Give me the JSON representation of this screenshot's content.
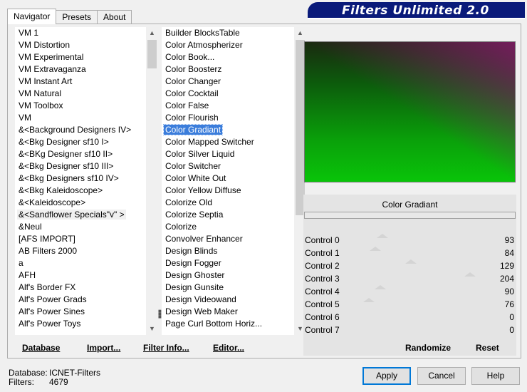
{
  "tabs": [
    "Navigator",
    "Presets",
    "About"
  ],
  "title": "Filters Unlimited 2.0",
  "categories": [
    "VM 1",
    "VM Distortion",
    "VM Experimental",
    "VM Extravaganza",
    "VM Instant Art",
    "VM Natural",
    "VM Toolbox",
    "VM",
    "&<Background Designers IV>",
    "&<Bkg Designer sf10 I>",
    "&<BKg Designer sf10 II>",
    "&<Bkg Designer sf10 III>",
    "&<Bkg Designers sf10 IV>",
    "&<Bkg Kaleidoscope>",
    "&<Kaleidoscope>",
    "&<Sandflower Specials\"v\" >",
    "&Neul",
    "[AFS IMPORT]",
    "AB Filters 2000",
    "a",
    "AFH",
    "Alf's Border FX",
    "Alf's Power Grads",
    "Alf's Power Sines",
    "Alf's Power Toys"
  ],
  "filters": [
    "Builder BlocksTable",
    "Color Atmospherizer",
    "Color Book...",
    "Color Boosterz",
    "Color Changer",
    "Color Cocktail",
    "Color False",
    "Color Flourish",
    "Color Gradiant",
    "Color Mapped Switcher",
    "Color Silver Liquid",
    "Color Switcher",
    "Color White Out",
    "Color Yellow Diffuse",
    "Colorize Old",
    "Colorize Septia",
    "Colorize",
    "Convolver Enhancer",
    "Design Blinds",
    "Design Fogger",
    "Design Ghoster",
    "Design Gunsite",
    "Design Videowand",
    "Design Web Maker",
    "Page Curl Bottom Horiz..."
  ],
  "selected_filter_name": "Color Gradiant",
  "controls": [
    {
      "label": "Control 0",
      "value": "93",
      "level": 93
    },
    {
      "label": "Control 1",
      "value": "84",
      "level": 84
    },
    {
      "label": "Control 2",
      "value": "129",
      "level": 129
    },
    {
      "label": "Control 3",
      "value": "204",
      "level": 204
    },
    {
      "label": "Control 4",
      "value": "90",
      "level": 90
    },
    {
      "label": "Control 5",
      "value": "76",
      "level": 76
    },
    {
      "label": "Control 6",
      "value": "0",
      "level": 0
    },
    {
      "label": "Control 7",
      "value": "0",
      "level": 0
    }
  ],
  "buttons": {
    "database": "Database",
    "import": "Import...",
    "filter_info": "Filter Info...",
    "editor": "Editor...",
    "randomize": "Randomize",
    "reset": "Reset",
    "apply": "Apply",
    "cancel": "Cancel",
    "help": "Help"
  },
  "status": {
    "database_label": "Database:",
    "database_value": "ICNET-Filters",
    "filters_label": "Filters:",
    "filters_value": "4679"
  },
  "colors": {
    "selection": "#3b7ddb",
    "title_banner": "#0a1a7a",
    "preview_green": "#09c409",
    "preview_purple": "#7d1c64"
  }
}
